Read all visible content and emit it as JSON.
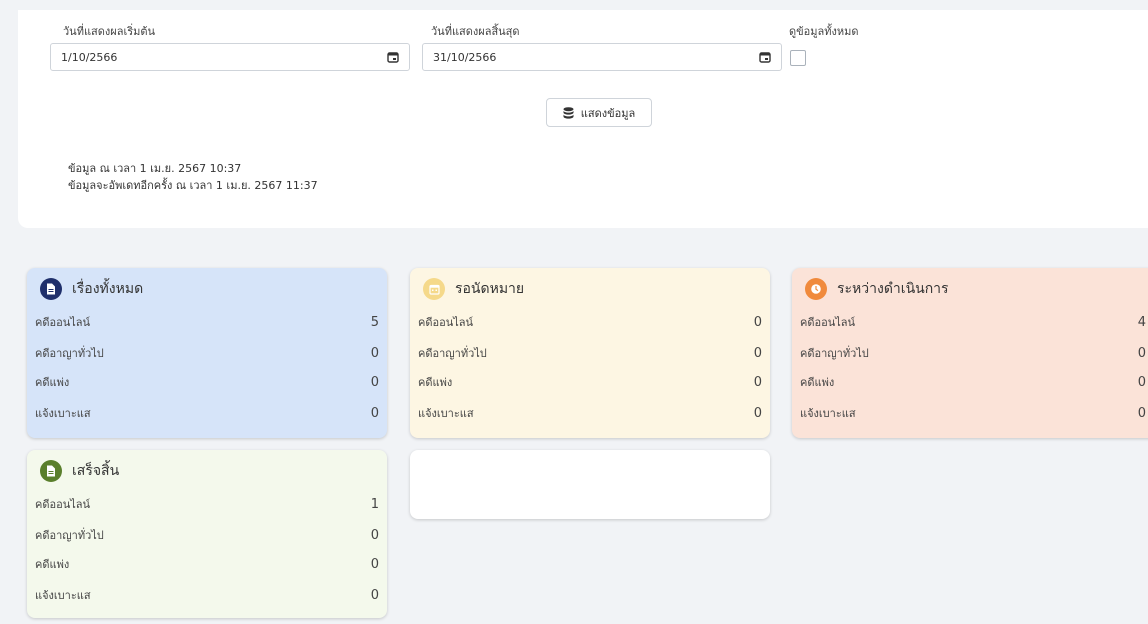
{
  "filters": {
    "start_label": "วันที่แสดงผลเริ่มต้น",
    "start_value": "1/10/2566",
    "end_label": "วันที่แสดงผลสิ้นสุด",
    "end_value": "31/10/2566",
    "all_label": "ดูข้อมูลทั้งหมด",
    "show_button": "แสดงข้อมูล"
  },
  "info": {
    "data_time": "ข้อมูล ณ เวลา 1 เม.ย. 2567 10:37",
    "next_update": "ข้อมูลจะอัพเดทอีกครั้ง ณ เวลา 1 เม.ย. 2567 11:37"
  },
  "colors": {
    "all_bg": "#d6e4f9",
    "pending_bg": "#fdf6e3",
    "progress_bg": "#fbe3d8",
    "done_bg": "#f4f9ec"
  },
  "cards": [
    {
      "title": "เรื่องทั้งหมด",
      "icon": "document-icon",
      "rows": [
        {
          "label": "คดีออนไลน์",
          "value": "5"
        },
        {
          "label": "คดีอาญาทั่วไป",
          "value": "0"
        },
        {
          "label": "คดีแพ่ง",
          "value": "0"
        },
        {
          "label": "แจ้งเบาะแส",
          "value": "0"
        }
      ]
    },
    {
      "title": "รอนัดหมาย",
      "icon": "calendar-icon",
      "rows": [
        {
          "label": "คดีออนไลน์",
          "value": "0"
        },
        {
          "label": "คดีอาญาทั่วไป",
          "value": "0"
        },
        {
          "label": "คดีแพ่ง",
          "value": "0"
        },
        {
          "label": "แจ้งเบาะแส",
          "value": "0"
        }
      ]
    },
    {
      "title": "ระหว่างดำเนินการ",
      "icon": "clock-icon",
      "rows": [
        {
          "label": "คดีออนไลน์",
          "value": "4"
        },
        {
          "label": "คดีอาญาทั่วไป",
          "value": "0"
        },
        {
          "label": "คดีแพ่ง",
          "value": "0"
        },
        {
          "label": "แจ้งเบาะแส",
          "value": "0"
        }
      ]
    },
    {
      "title": "เสร็จสิ้น",
      "icon": "document-check-icon",
      "rows": [
        {
          "label": "คดีออนไลน์",
          "value": "1"
        },
        {
          "label": "คดีอาญาทั่วไป",
          "value": "0"
        },
        {
          "label": "คดีแพ่ง",
          "value": "0"
        },
        {
          "label": "แจ้งเบาะแส",
          "value": "0"
        }
      ]
    }
  ]
}
